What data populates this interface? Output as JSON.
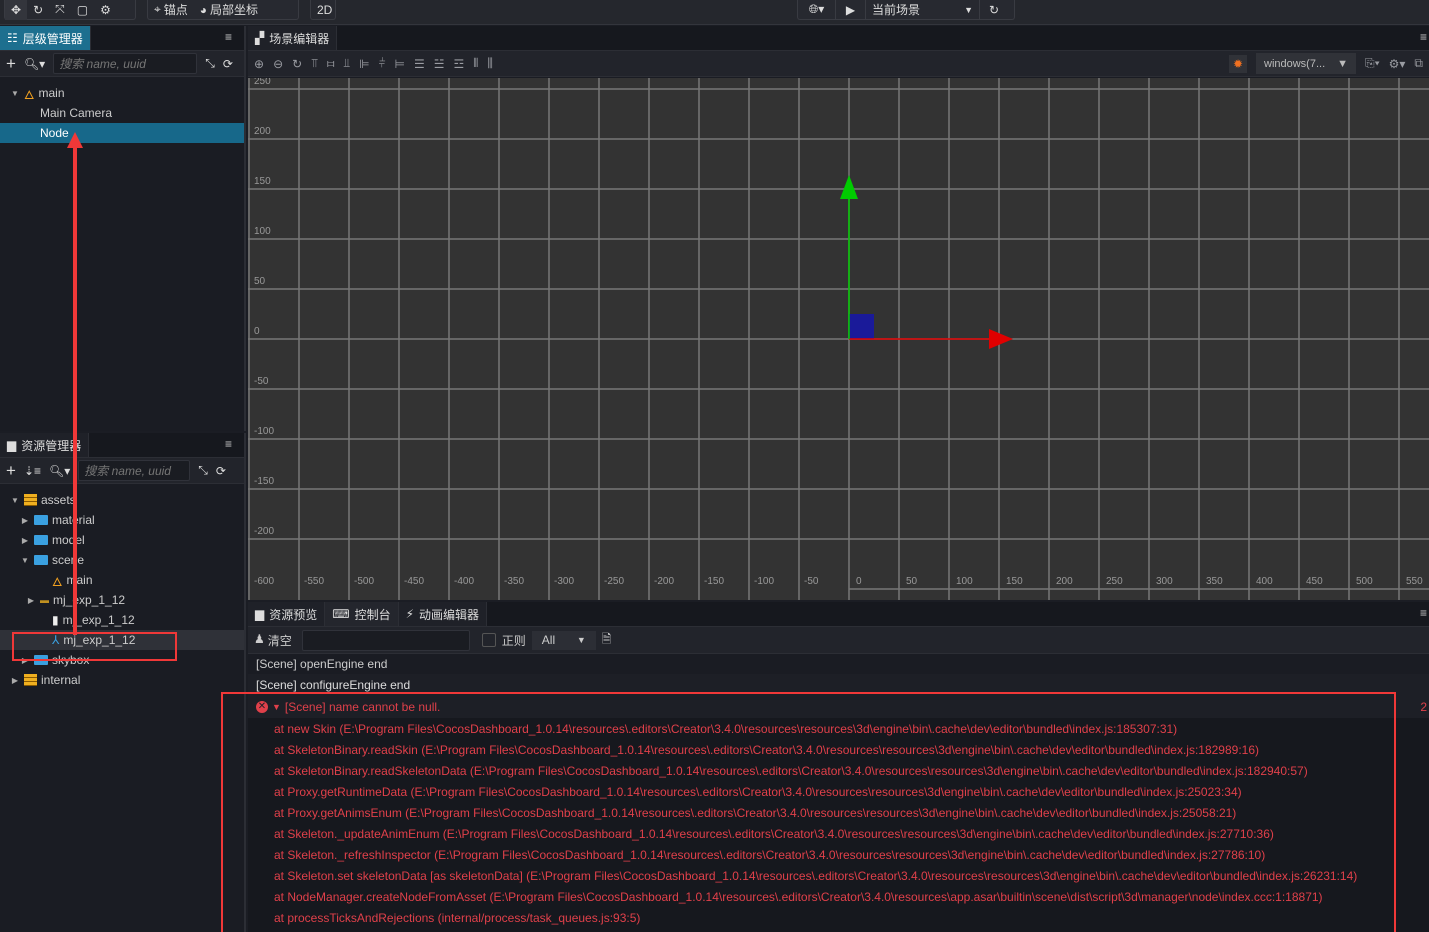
{
  "toolbar": {
    "anchor": "锚点",
    "local": "局部坐标",
    "mode2d": "2D",
    "scene_select": "当前场景"
  },
  "hierarchy": {
    "title": "层级管理器",
    "search_placeholder": "搜索 name, uuid",
    "items": [
      "main",
      "Main Camera",
      "Node"
    ]
  },
  "assets": {
    "title": "资源管理器",
    "search_placeholder": "搜索 name, uuid",
    "items": [
      {
        "label": "assets",
        "icon": "database-icon"
      },
      {
        "label": "material",
        "icon": "folder-icon"
      },
      {
        "label": "model",
        "icon": "folder-icon"
      },
      {
        "label": "scene",
        "icon": "folder-icon"
      },
      {
        "label": "main",
        "icon": "scene-icon"
      },
      {
        "label": "mj_exp_1_12",
        "icon": "spine-atlas-icon"
      },
      {
        "label": "mj_exp_1_12",
        "icon": "file-icon"
      },
      {
        "label": "mj_exp_1_12",
        "icon": "skeleton-icon"
      },
      {
        "label": "skybox",
        "icon": "folder-icon"
      },
      {
        "label": "internal",
        "icon": "database-icon"
      }
    ]
  },
  "scene": {
    "title": "场景编辑器",
    "platform": "windows(7...",
    "x_labels": [
      "-600",
      "-550",
      "-500",
      "-450",
      "-400",
      "-350",
      "-300",
      "-250",
      "-200",
      "-150",
      "-100",
      "-50",
      "0",
      "50",
      "100",
      "150",
      "200",
      "250",
      "300",
      "350",
      "400",
      "450",
      "500",
      "550"
    ],
    "y_labels": [
      "250",
      "200",
      "150",
      "100",
      "50",
      "0",
      "-50",
      "-100",
      "-150",
      "-200"
    ],
    "colors": {
      "x_axis": "#e00000",
      "y_axis": "#00cc00",
      "z": "#1a1a99"
    }
  },
  "console": {
    "tabs": [
      "资源预览",
      "控制台",
      "动画编辑器"
    ],
    "clear": "清空",
    "regex": "正则",
    "level": "All",
    "logs": [
      "[Scene] openEngine end",
      "[Scene] configureEngine end"
    ],
    "error": {
      "title": "[Scene] name cannot be null.",
      "count": "2",
      "stack": [
        "at new Skin (E:\\Program Files\\CocosDashboard_1.0.14\\resources\\.editors\\Creator\\3.4.0\\resources\\resources\\3d\\engine\\bin\\.cache\\dev\\editor\\bundled\\index.js:185307:31)",
        "at SkeletonBinary.readSkin (E:\\Program Files\\CocosDashboard_1.0.14\\resources\\.editors\\Creator\\3.4.0\\resources\\resources\\3d\\engine\\bin\\.cache\\dev\\editor\\bundled\\index.js:182989:16)",
        "at SkeletonBinary.readSkeletonData (E:\\Program Files\\CocosDashboard_1.0.14\\resources\\.editors\\Creator\\3.4.0\\resources\\resources\\3d\\engine\\bin\\.cache\\dev\\editor\\bundled\\index.js:182940:57)",
        "at Proxy.getRuntimeData (E:\\Program Files\\CocosDashboard_1.0.14\\resources\\.editors\\Creator\\3.4.0\\resources\\resources\\3d\\engine\\bin\\.cache\\dev\\editor\\bundled\\index.js:25023:34)",
        "at Proxy.getAnimsEnum (E:\\Program Files\\CocosDashboard_1.0.14\\resources\\.editors\\Creator\\3.4.0\\resources\\resources\\3d\\engine\\bin\\.cache\\dev\\editor\\bundled\\index.js:25058:21)",
        "at Skeleton._updateAnimEnum (E:\\Program Files\\CocosDashboard_1.0.14\\resources\\.editors\\Creator\\3.4.0\\resources\\resources\\3d\\engine\\bin\\.cache\\dev\\editor\\bundled\\index.js:27710:36)",
        "at Skeleton._refreshInspector (E:\\Program Files\\CocosDashboard_1.0.14\\resources\\.editors\\Creator\\3.4.0\\resources\\resources\\3d\\engine\\bin\\.cache\\dev\\editor\\bundled\\index.js:27786:10)",
        "at Skeleton.set skeletonData [as skeletonData] (E:\\Program Files\\CocosDashboard_1.0.14\\resources\\.editors\\Creator\\3.4.0\\resources\\resources\\3d\\engine\\bin\\.cache\\dev\\editor\\bundled\\index.js:26231:14)",
        "at NodeManager.createNodeFromAsset (E:\\Program Files\\CocosDashboard_1.0.14\\resources\\.editors\\Creator\\3.4.0\\resources\\app.asar\\builtin\\scene\\dist\\script\\3d\\manager\\node\\index.ccc:1:18871)",
        "at processTicksAndRejections (internal/process/task_queues.js:93:5)"
      ]
    }
  }
}
